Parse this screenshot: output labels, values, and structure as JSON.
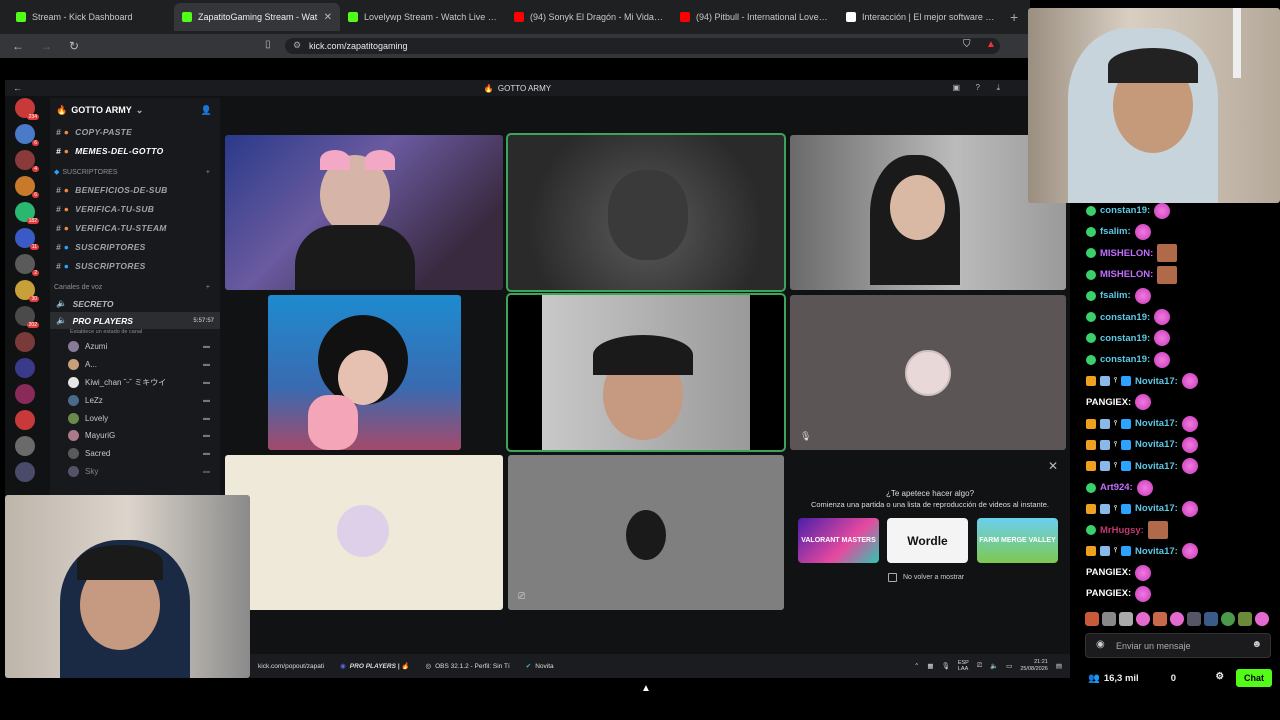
{
  "browser": {
    "tabs": [
      {
        "label": "Stream - Kick Dashboard",
        "color": "#53fc18"
      },
      {
        "label": "ZapatitoGaming Stream - Wat",
        "color": "#53fc18",
        "active": true
      },
      {
        "label": "Lovelywp Stream - Watch Live on Kic",
        "color": "#53fc18"
      },
      {
        "label": "(94) Sonyk El Dragón - Mi Vida Eres",
        "color": "#ff0000"
      },
      {
        "label": "(94) Pitbull - International Love (Offic",
        "color": "#ff0000"
      },
      {
        "label": "Interacción | El mejor software para p",
        "color": "#ffffff"
      }
    ],
    "url": "kick.com/zapatitogaming"
  },
  "discord": {
    "window_title": "GOTTO ARMY",
    "server_name": "GOTTO ARMY",
    "server_badges": [
      "234",
      "6",
      "4",
      "6",
      "182",
      "11",
      "2",
      "30",
      "202"
    ],
    "text_channels": [
      "COPY-PASTE",
      "MEMES-DEL-GOTTO"
    ],
    "subs_category": "SUSCRIPTORES",
    "sub_channels": [
      "BENEFICIOS-DE-SUB",
      "VERIFICA-TU-SUB",
      "VERIFICA-TU-STEAM",
      "SUSCRIPTORES",
      "SUSCRIPTORES"
    ],
    "voice_category": "Canales de voz",
    "voice_channels": [
      "SECRETO",
      "PRO PLAYERS"
    ],
    "voice_timer": "5:57:57",
    "voice_status": "Establece un estado de canal",
    "members": [
      "Azumi",
      "A...",
      "Kiwi_chan ˘ᵕ˘ ミキウイ",
      "LeZz",
      "Lovely",
      "MayuriG",
      "Sacred",
      "Sky"
    ],
    "popup": {
      "title": "¿Te apetece hacer algo?",
      "subtitle": "Comienza una partida o una lista de reproducción de videos al instante.",
      "games": [
        "VALORANT MASTERS",
        "Wordle",
        "FARM MERGE VALLEY"
      ],
      "checkbox_label": "No volver a mostrar"
    }
  },
  "taskbar": {
    "items": [
      "kick.com/popout/zapati",
      "PRO PLAYERS | 🔥",
      "OBS 32.1.2 - Perfil: Sin Tí",
      "Novita"
    ],
    "lang": "ESP\nLAA",
    "time": "21:21",
    "date": "25/08/2026"
  },
  "chat": {
    "messages": [
      {
        "user": "constan19:",
        "color": "#5cc9e6"
      },
      {
        "user": "fsalim:",
        "color": "#5cc9e6"
      },
      {
        "user": "MISHELON:",
        "color": "#c36eff"
      },
      {
        "user": "MISHELON:",
        "color": "#c36eff"
      },
      {
        "user": "fsalim:",
        "color": "#5cc9e6"
      },
      {
        "user": "constan19:",
        "color": "#5cc9e6"
      },
      {
        "user": "constan19:",
        "color": "#5cc9e6"
      },
      {
        "user": "constan19:",
        "color": "#5cc9e6"
      },
      {
        "user": "Novita17:",
        "color": "#5cc9e6",
        "badges": true
      },
      {
        "user": "PANGIEX:",
        "color": "#ffffff"
      },
      {
        "user": "Novita17:",
        "color": "#5cc9e6",
        "badges": true
      },
      {
        "user": "Novita17:",
        "color": "#5cc9e6",
        "badges": true
      },
      {
        "user": "Novita17:",
        "color": "#5cc9e6",
        "badges": true
      },
      {
        "user": "Art924:",
        "color": "#c36eff"
      },
      {
        "user": "Novita17:",
        "color": "#5cc9e6",
        "badges": true
      },
      {
        "user": "MrHugsy:",
        "color": "#c3386e"
      },
      {
        "user": "Novita17:",
        "color": "#5cc9e6",
        "badges": true
      },
      {
        "user": "PANGIEX:",
        "color": "#ffffff"
      },
      {
        "user": "PANGIEX:",
        "color": "#ffffff"
      }
    ],
    "input_placeholder": "Enviar un mensaje",
    "viewers": "16,3 mil",
    "points": "0",
    "chat_button": "Chat"
  }
}
